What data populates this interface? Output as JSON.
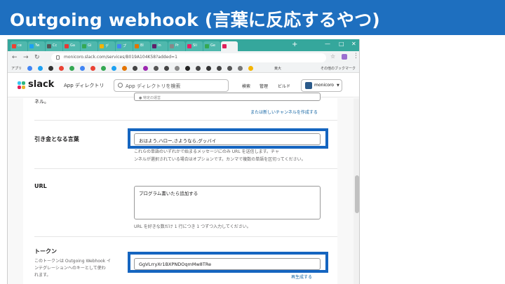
{
  "slide": {
    "title": "Outgoing webhook (言葉に反応するやつ)",
    "banner_color": "#1e6fbf"
  },
  "browser": {
    "tabs": [
      {
        "label": "ce",
        "color": "#ea4335"
      },
      {
        "label": "Tw",
        "color": "#1da1f2"
      },
      {
        "label": "Cc",
        "color": "#555555"
      },
      {
        "label": "Ga",
        "color": "#e53935"
      },
      {
        "label": "Gi",
        "color": "#34a853"
      },
      {
        "label": "デ",
        "color": "#f4b400"
      },
      {
        "label": "プ",
        "color": "#4285f4"
      },
      {
        "label": "Bl",
        "color": "#e37400"
      },
      {
        "label": "In",
        "color": "#611f69"
      },
      {
        "label": "Pr",
        "color": "#888888"
      },
      {
        "label": "Sli",
        "color": "#e91e63"
      },
      {
        "label": "Ge",
        "color": "#34a853"
      },
      {
        "label": "",
        "color": "#e01e5a"
      }
    ],
    "new_tab": "+",
    "url": "monicoro.slack.com/services/B019A104K58?added=1",
    "bookmarks_apps": "アプリ",
    "bookmarks_right": [
      "東大",
      "その他のブックマーク"
    ],
    "icons": [
      "back-icon",
      "forward-icon",
      "reload-icon",
      "lock-icon",
      "star-icon",
      "extension-icon",
      "menu-icon"
    ]
  },
  "slack": {
    "logo": "slack",
    "app_directory": "App ディレクトリ",
    "search_placeholder": "App ディレクトリを検索",
    "nav": [
      "検索",
      "管理",
      "ビルド"
    ],
    "workspace": "monicoro",
    "avatar_color": "#2b5a8a"
  },
  "form": {
    "channel_label_tail": "ネル。",
    "channel_select_hint": "● 特定の運営",
    "create_channel_link": "または新しいチャンネルを作成する",
    "trigger": {
      "label": "引き金となる言葉",
      "value": "おはよう,ハロー,さようなら,グッバイ",
      "help_1": "これらの単語のいずれかで始まるメッセージにのみ URL を送信します。チャ",
      "help_2": "ンネルが選択されている場合はオプションです。カンマで複数の単語を区切ってください。"
    },
    "url": {
      "label": "URL",
      "value": "プログラム書いたら追加する",
      "help": "URL を好きな数だけ 1 行につき 1 つずつ入力してください。"
    },
    "token": {
      "label": "トークン",
      "desc_1": "このトークンは Outgoing Webhook イ",
      "desc_2": "ンテグレーションへのキーとして使わ",
      "desc_3": "れます。",
      "value": "GgVLrryXr1BXPNDOqmMw8TRe",
      "regenerate": "再生成する"
    }
  },
  "highlight_color": "#1565c0"
}
